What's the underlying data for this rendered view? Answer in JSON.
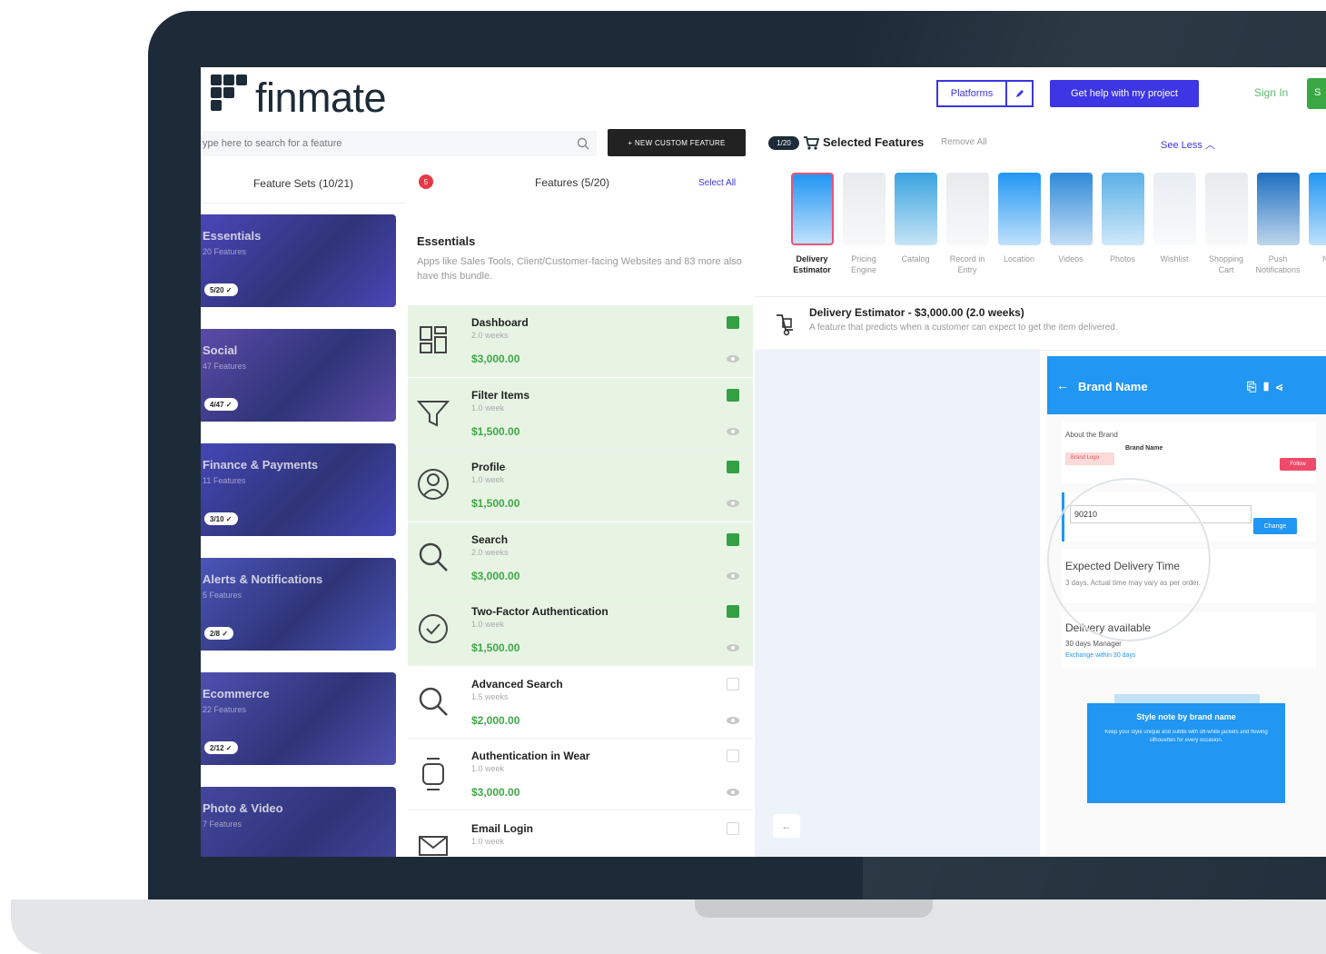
{
  "colors": {
    "bezel": "#1d2b38",
    "accent": "#3c36e4",
    "success": "#33a043",
    "price": "#3ea846",
    "phone_primary": "#2196f3"
  },
  "header": {
    "logo_text": "finmate",
    "platforms_label": "Platforms",
    "edit_icon": "pencil-icon",
    "help_label": "Get help with my project",
    "signin_label": "Sign In",
    "signup_label": "S"
  },
  "search": {
    "placeholder": "ype here to search for a feature",
    "new_feature_label": "+ NEW CUSTOM FEATURE"
  },
  "feature_sets": {
    "header": "Feature Sets (10/21)",
    "items": [
      {
        "title": "Essentials",
        "sub": "20 Features",
        "badge": "5/20 ✓",
        "color": "#4b46b8"
      },
      {
        "title": "Social",
        "sub": "47 Features",
        "badge": "4/47 ✓",
        "color": "#5b4ba8"
      },
      {
        "title": "Finance & Payments",
        "sub": "11 Features",
        "badge": "3/10 ✓",
        "color": "#4447b5"
      },
      {
        "title": "Alerts & Notifications",
        "sub": "5 Features",
        "badge": "2/8 ✓",
        "color": "#4a55b8"
      },
      {
        "title": "Ecommerce",
        "sub": "22 Features",
        "badge": "2/12 ✓",
        "color": "#5050b0"
      },
      {
        "title": "Photo & Video",
        "sub": "7 Features",
        "badge": "",
        "color": "#45469e"
      }
    ]
  },
  "features": {
    "notif_count": "5",
    "header": "Features (5/20)",
    "select_all": "Select All",
    "bundle_title": "Essentials",
    "bundle_desc": "Apps like Sales Tools, Client/Customer-facing Websites and 83 more also have this bundle.",
    "items": [
      {
        "name": "Dashboard",
        "duration": "2.0 weeks",
        "price": "$3,000.00",
        "selected": true,
        "icon": "dashboard-icon"
      },
      {
        "name": "Filter Items",
        "duration": "1.0 week",
        "price": "$1,500.00",
        "selected": true,
        "icon": "filter-icon"
      },
      {
        "name": "Profile",
        "duration": "1.0 week",
        "price": "$1,500.00",
        "selected": true,
        "icon": "profile-icon"
      },
      {
        "name": "Search",
        "duration": "2.0 weeks",
        "price": "$3,000.00",
        "selected": true,
        "icon": "search-icon"
      },
      {
        "name": "Two-Factor Authentication",
        "duration": "1.0 week",
        "price": "$1,500.00",
        "selected": true,
        "icon": "shield-check-icon"
      },
      {
        "name": "Advanced Search",
        "duration": "1.5 weeks",
        "price": "$2,000.00",
        "selected": false,
        "icon": "search-icon"
      },
      {
        "name": "Authentication in Wear",
        "duration": "1.0 week",
        "price": "$3,000.00",
        "selected": false,
        "icon": "watch-icon"
      },
      {
        "name": "Email Login",
        "duration": "1.0 week",
        "price": "",
        "selected": false,
        "icon": "envelope-icon"
      }
    ]
  },
  "selected": {
    "count": "1/20",
    "title": "Selected Features",
    "remove_all": "Remove All",
    "see_less": "See Less",
    "thumbs": [
      {
        "label": "Delivery Estimator",
        "active": true,
        "color": "#2196f3"
      },
      {
        "label": "Pricing Engine",
        "active": false,
        "color": "#e8eaed"
      },
      {
        "label": "Catalog",
        "active": false,
        "color": "#3aa3e0"
      },
      {
        "label": "Record in Entry",
        "active": false,
        "color": "#e8eaed"
      },
      {
        "label": "Location",
        "active": false,
        "color": "#2196f3"
      },
      {
        "label": "Videos",
        "active": false,
        "color": "#2f89d9"
      },
      {
        "label": "Photos",
        "active": false,
        "color": "#5ab0e8"
      },
      {
        "label": "Wishlist",
        "active": false,
        "color": "#e9eef3"
      },
      {
        "label": "Shopping Cart",
        "active": false,
        "color": "#e8eaed"
      },
      {
        "label": "Push Notifications",
        "active": false,
        "color": "#1e6fc0"
      },
      {
        "label": "Noti",
        "active": false,
        "color": "#2196f3"
      }
    ]
  },
  "detail": {
    "title": "Delivery Estimator - $3,000.00 (2.0 weeks)",
    "desc": "A feature that predicts when a customer can expect to get the item delivered."
  },
  "phone": {
    "title": "Brand Name",
    "about": "About the Brand",
    "brand_name": "Brand Name",
    "brand_logo": "Brand Logo",
    "follow": "Follow",
    "zip_value": "90210",
    "change": "Change",
    "expected_title": "Expected Delivery Time",
    "expected_desc": "3 days. Actual time may vary as per order.",
    "delivery_title": "Delivery available",
    "delivery_note": "30 days Manager",
    "delivery_link": "Exchange within 30 days",
    "tip_title": "Style note by brand name",
    "tip_body": "Keep your style unique and subtle with off-white jackets and flowing silhouettes for every occasion."
  }
}
